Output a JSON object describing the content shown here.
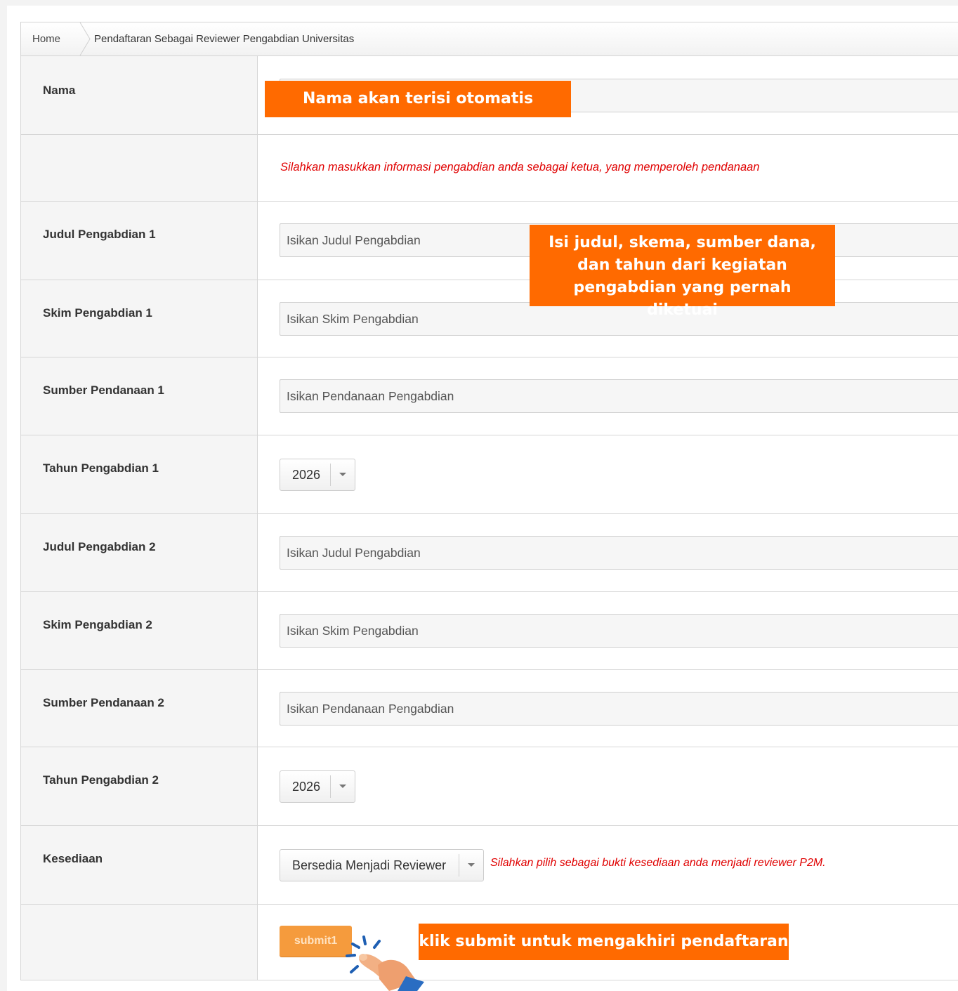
{
  "breadcrumb": {
    "home": "Home",
    "current": "Pendaftaran Sebagai Reviewer Pengabdian Universitas"
  },
  "form": {
    "nama_label": "Nama",
    "info_text": "Silahkan masukkan informasi pengabdian anda sebagai ketua, yang memperoleh pendanaan",
    "fields": [
      {
        "label": "Judul Pengabdian 1",
        "placeholder": "Isikan Judul Pengabdian"
      },
      {
        "label": "Skim Pengabdian 1",
        "placeholder": "Isikan Skim Pengabdian"
      },
      {
        "label": "Sumber Pendanaan 1",
        "placeholder": "Isikan Pendanaan Pengabdian"
      },
      {
        "label": "Tahun Pengabdian 1",
        "value": "2026"
      },
      {
        "label": "Judul Pengabdian 2",
        "placeholder": "Isikan Judul Pengabdian"
      },
      {
        "label": "Skim Pengabdian 2",
        "placeholder": "Isikan Skim Pengabdian"
      },
      {
        "label": "Sumber Pendanaan 2",
        "placeholder": "Isikan Pendanaan Pengabdian"
      },
      {
        "label": "Tahun Pengabdian 2",
        "value": "2026"
      }
    ],
    "kesediaan": {
      "label": "Kesediaan",
      "value": "Bersedia Menjadi Reviewer",
      "hint": "Silahkan pilih sebagai bukti kesediaan anda menjadi reviewer P2M."
    },
    "submit_label": "submit1"
  },
  "callouts": {
    "nama": "Nama akan terisi otomatis",
    "fill": "Isi judul, skema, sumber dana, dan tahun dari kegiatan pengabdian yang pernah diketuai",
    "submit": "klik submit untuk mengakhiri pendaftaran"
  },
  "colors": {
    "callout": "#ff6a00",
    "hint": "#e00000",
    "submit": "#f59b3d"
  },
  "icons": {
    "dropdown": "caret-down-icon",
    "pointer": "pointing-hand-icon"
  }
}
